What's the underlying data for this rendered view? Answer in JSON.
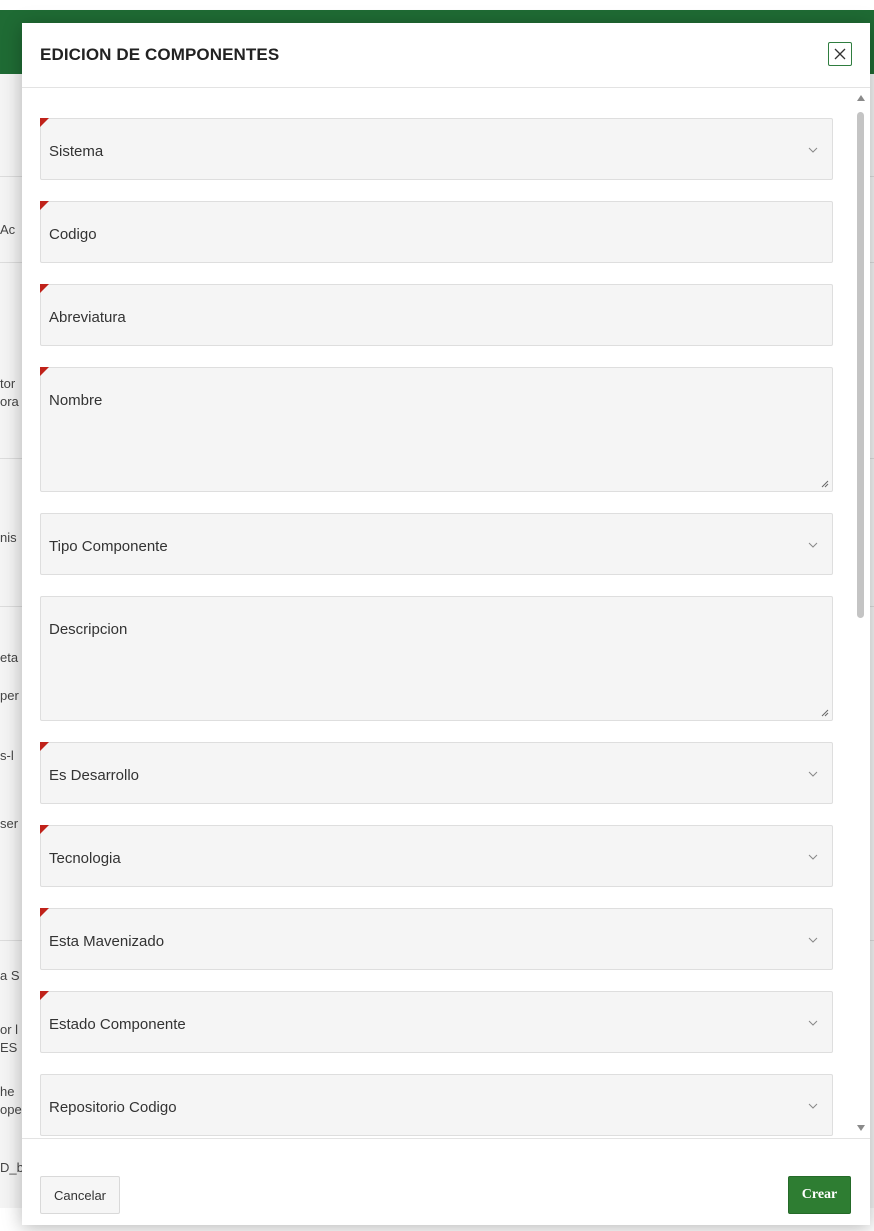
{
  "modal": {
    "title": "EDICION DE COMPONENTES",
    "close_icon": "close-icon"
  },
  "fields": [
    {
      "label": "Sistema",
      "type": "select",
      "required": true
    },
    {
      "label": "Codigo",
      "type": "text",
      "required": true
    },
    {
      "label": "Abreviatura",
      "type": "text",
      "required": true
    },
    {
      "label": "Nombre",
      "type": "textarea",
      "required": true
    },
    {
      "label": "Tipo Componente",
      "type": "select",
      "required": false
    },
    {
      "label": "Descripcion",
      "type": "textarea",
      "required": false
    },
    {
      "label": "Es Desarrollo",
      "type": "select",
      "required": true
    },
    {
      "label": "Tecnologia",
      "type": "select",
      "required": true
    },
    {
      "label": "Esta Mavenizado",
      "type": "select",
      "required": true
    },
    {
      "label": "Estado Componente",
      "type": "select",
      "required": true
    },
    {
      "label": "Repositorio Codigo",
      "type": "select",
      "required": false
    }
  ],
  "footer": {
    "cancel_label": "Cancelar",
    "create_label": "Crear"
  },
  "colors": {
    "accent_green": "#2e7d32",
    "header_green": "#1f6b34",
    "required_marker": "#c0221a"
  },
  "background_fragments": [
    "Ac",
    "tor",
    "ora",
    "nis",
    "eta",
    "per",
    "s-l",
    "ser",
    "a S",
    "or l",
    "ES",
    "he",
    "ope",
    "D_b"
  ]
}
